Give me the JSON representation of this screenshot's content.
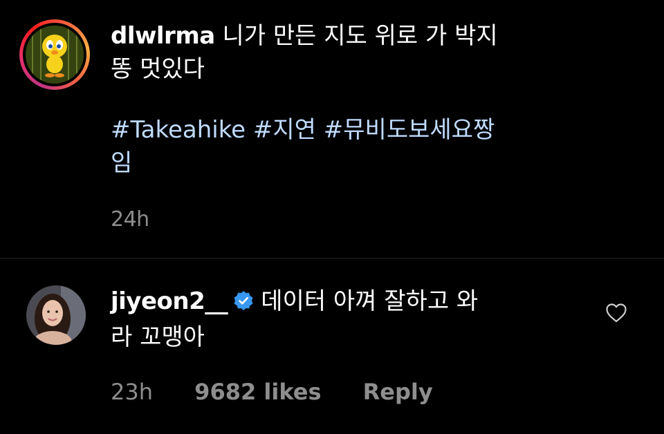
{
  "post": {
    "username": "dlwlrma",
    "caption_line1": " 니가 만든 지도 위로 가 박지",
    "caption_line2": "똥 멋있다",
    "hashtags": [
      "#Takeahike",
      "#지연",
      "#뮤비도보세요짱"
    ],
    "hashtags_tail": "임",
    "time": "24h",
    "avatar_icon": "tweety-bird-avatar"
  },
  "comment": {
    "username": "jiyeon2__",
    "verified_icon": "verified-badge-icon",
    "text_line1": "데이터 아껴 잘하고 와",
    "text_line2": "라 꼬맹아",
    "time": "23h",
    "likes": "9682 likes",
    "reply": "Reply",
    "like_icon": "heart-icon"
  },
  "colors": {
    "background": "#000000",
    "text": "#ffffff",
    "muted": "#8e8e8e",
    "hashtag": "#c0dbff",
    "verified": "#3897f0"
  }
}
